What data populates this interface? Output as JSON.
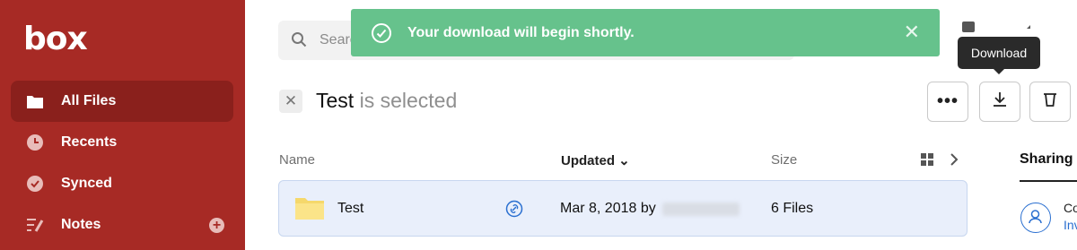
{
  "sidebar": {
    "logo": "box",
    "items": [
      {
        "label": "All Files",
        "icon": "folder-icon",
        "active": true
      },
      {
        "label": "Recents",
        "icon": "clock-icon",
        "active": false
      },
      {
        "label": "Synced",
        "icon": "check-circle-icon",
        "active": false
      },
      {
        "label": "Notes",
        "icon": "notes-icon",
        "active": false,
        "add": "+"
      }
    ],
    "colors": {
      "background": "#a72a25",
      "active": "#8a201c"
    }
  },
  "search": {
    "placeholder": "Search Files and Folders"
  },
  "toast": {
    "message": "Your download will begin shortly.",
    "close": "✕",
    "color": "#66c28c"
  },
  "tooltip": {
    "text": "Download"
  },
  "selection": {
    "name": "Test",
    "suffix": " is selected",
    "deselect": "✕"
  },
  "actions": {
    "more": "•••"
  },
  "table": {
    "columns": {
      "name": "Name",
      "updated": "Updated",
      "size": "Size",
      "updated_sort": "⌄"
    },
    "rows": [
      {
        "name": "Test",
        "updated": "Mar 8, 2018 by",
        "size": "6 Files"
      }
    ]
  },
  "right_panel": {
    "tab": "Sharing",
    "collaborators": "Collaborators",
    "invite": "Invite People"
  }
}
